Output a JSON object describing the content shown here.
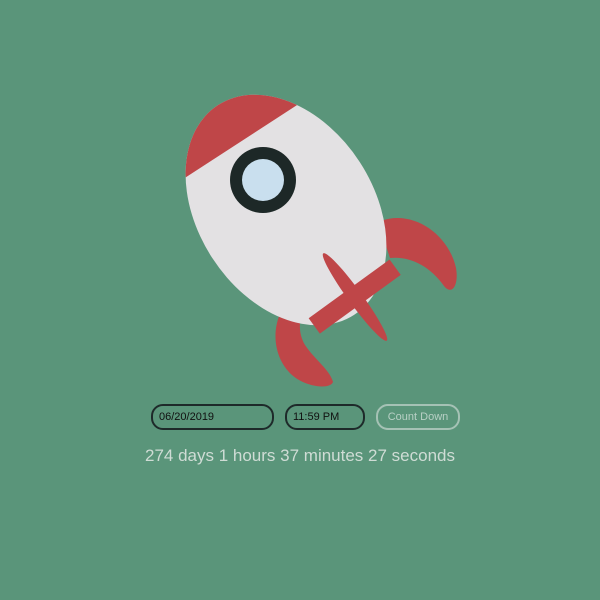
{
  "colors": {
    "background": "#5a957a",
    "rocket_body": "#e3e1e3",
    "rocket_accent": "#bf4648",
    "window_frame": "#1d2827",
    "window_glass": "#c9dfee"
  },
  "form": {
    "date_value": "06/20/2019",
    "time_value": "11:59 PM",
    "button_label": "Count Down"
  },
  "countdown": {
    "text": "274 days 1 hours 37 minutes 27 seconds"
  }
}
